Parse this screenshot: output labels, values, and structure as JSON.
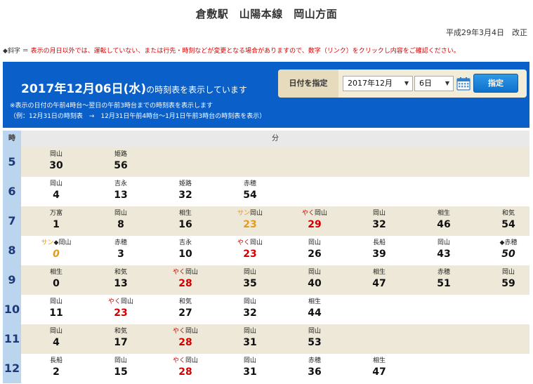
{
  "page": {
    "title": "倉敷駅　山陽本線　岡山方面",
    "revision": "平成29年3月4日　改正",
    "legend_key": "◆斜字 ＝",
    "legend_text": " 表示の月日以外では、運転していない、または行先・時刻などが変更となる場合がありますので、数字（リンク）をクリックし内容をご確認ください。"
  },
  "banner": {
    "title": "2017年12月06日(水)",
    "title_suffix": "の時刻表を表示しています",
    "note1": "※表示の日付の午前4時台～翌日の午前3時台までの時刻表を表示します",
    "note2": "（例：12月31日の時刻表　→　12月31日午前4時台～1月1日午前3時台の時刻表を表示）"
  },
  "date_picker": {
    "label": "日付を指定",
    "month_value": "2017年12月",
    "day_value": "6日",
    "submit_label": "指定"
  },
  "table": {
    "hour_header": "時",
    "minute_header": "分",
    "hours": [
      {
        "hour": "5",
        "deps": [
          {
            "dest": "岡山",
            "min": "30"
          },
          {
            "dest": "姫路",
            "min": "56"
          }
        ]
      },
      {
        "hour": "6",
        "deps": [
          {
            "dest": "岡山",
            "min": "4"
          },
          {
            "dest": "吉永",
            "min": "13"
          },
          {
            "dest": "姫路",
            "min": "32"
          },
          {
            "dest": "赤穂",
            "min": "54"
          }
        ]
      },
      {
        "hour": "7",
        "deps": [
          {
            "dest": "万富",
            "min": "1"
          },
          {
            "dest": "岡山",
            "min": "8"
          },
          {
            "dest": "相生",
            "min": "16"
          },
          {
            "mark": "サン",
            "mark_type": "san",
            "dest": "岡山",
            "min": "23",
            "style": "orange"
          },
          {
            "mark": "やく",
            "mark_type": "yaku",
            "dest": "岡山",
            "min": "29",
            "style": "red"
          },
          {
            "dest": "岡山",
            "min": "32"
          },
          {
            "dest": "相生",
            "min": "46"
          },
          {
            "dest": "和気",
            "min": "54"
          }
        ]
      },
      {
        "hour": "8",
        "deps": [
          {
            "mark": "サン",
            "mark_type": "san",
            "mark2": "◆",
            "dest": "岡山",
            "min": "0",
            "style": "orange-italic"
          },
          {
            "dest": "赤穂",
            "min": "3"
          },
          {
            "dest": "吉永",
            "min": "10"
          },
          {
            "mark": "やく",
            "mark_type": "yaku",
            "dest": "岡山",
            "min": "23",
            "style": "red"
          },
          {
            "dest": "岡山",
            "min": "26"
          },
          {
            "dest": "長船",
            "min": "39"
          },
          {
            "dest": "岡山",
            "min": "43"
          },
          {
            "mark": "◆",
            "mark_type": "dia",
            "dest": "赤穂",
            "min": "50",
            "style": "italic"
          }
        ]
      },
      {
        "hour": "9",
        "deps": [
          {
            "dest": "相生",
            "min": "0"
          },
          {
            "dest": "和気",
            "min": "13"
          },
          {
            "mark": "やく",
            "mark_type": "yaku",
            "dest": "岡山",
            "min": "28",
            "style": "red"
          },
          {
            "dest": "岡山",
            "min": "35"
          },
          {
            "dest": "岡山",
            "min": "40"
          },
          {
            "dest": "相生",
            "min": "47"
          },
          {
            "dest": "赤穂",
            "min": "51"
          },
          {
            "dest": "岡山",
            "min": "59"
          }
        ]
      },
      {
        "hour": "10",
        "deps": [
          {
            "dest": "岡山",
            "min": "11"
          },
          {
            "mark": "やく",
            "mark_type": "yaku",
            "dest": "岡山",
            "min": "23",
            "style": "red"
          },
          {
            "dest": "和気",
            "min": "27"
          },
          {
            "dest": "岡山",
            "min": "32"
          },
          {
            "dest": "相生",
            "min": "44"
          }
        ]
      },
      {
        "hour": "11",
        "deps": [
          {
            "dest": "岡山",
            "min": "4"
          },
          {
            "dest": "和気",
            "min": "17"
          },
          {
            "mark": "やく",
            "mark_type": "yaku",
            "dest": "岡山",
            "min": "28",
            "style": "red"
          },
          {
            "dest": "岡山",
            "min": "31"
          },
          {
            "dest": "岡山",
            "min": "53"
          }
        ]
      },
      {
        "hour": "12",
        "deps": [
          {
            "dest": "長船",
            "min": "2"
          },
          {
            "dest": "岡山",
            "min": "15"
          },
          {
            "mark": "やく",
            "mark_type": "yaku",
            "dest": "岡山",
            "min": "28",
            "style": "red"
          },
          {
            "dest": "岡山",
            "min": "31"
          },
          {
            "dest": "赤穂",
            "min": "36"
          },
          {
            "dest": "相生",
            "min": "47"
          }
        ]
      }
    ]
  }
}
